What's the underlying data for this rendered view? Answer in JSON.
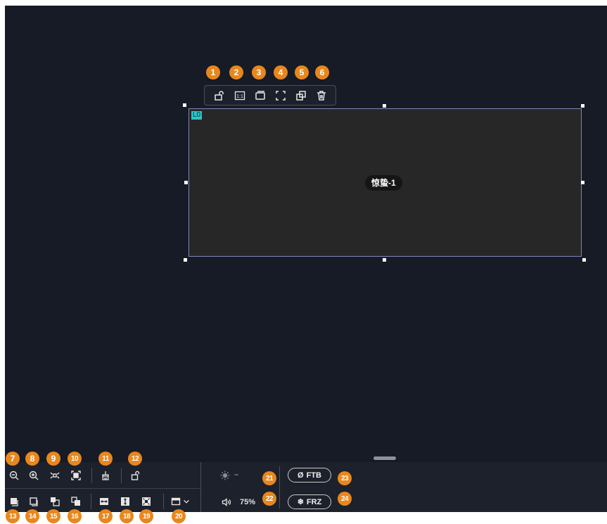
{
  "layer": {
    "tag": "L0",
    "name": "惊蛰-1"
  },
  "float_toolbar": {
    "buttons": [
      {
        "icon": "unlock-icon"
      },
      {
        "icon": "one-to-one-icon",
        "label": "1:1"
      },
      {
        "icon": "window-icon"
      },
      {
        "icon": "fullscreen-icon"
      },
      {
        "icon": "copy-icon"
      },
      {
        "icon": "delete-icon"
      }
    ]
  },
  "bottom_toolbar": {
    "brightness_value": "–",
    "volume_value": "75%",
    "ftb_label": "FTB",
    "frz_label": "FRZ"
  },
  "badges": {
    "b1": "1",
    "b2": "2",
    "b3": "3",
    "b4": "4",
    "b5": "5",
    "b6": "6",
    "b7": "7",
    "b8": "8",
    "b9": "9",
    "b10": "10",
    "b11": "11",
    "b12": "12",
    "b13": "13",
    "b14": "14",
    "b15": "15",
    "b16": "16",
    "b17": "17",
    "b18": "18",
    "b19": "19",
    "b20": "20",
    "b21": "21",
    "b22": "22",
    "b23": "23",
    "b24": "24"
  },
  "colors": {
    "canvas_bg": "#171b25",
    "toolbar_bg": "#1d212b",
    "layer_bg": "#272727",
    "layer_border": "#7f85ba",
    "layer_tag": "#2ec4c8",
    "badge": "#e8871e"
  }
}
